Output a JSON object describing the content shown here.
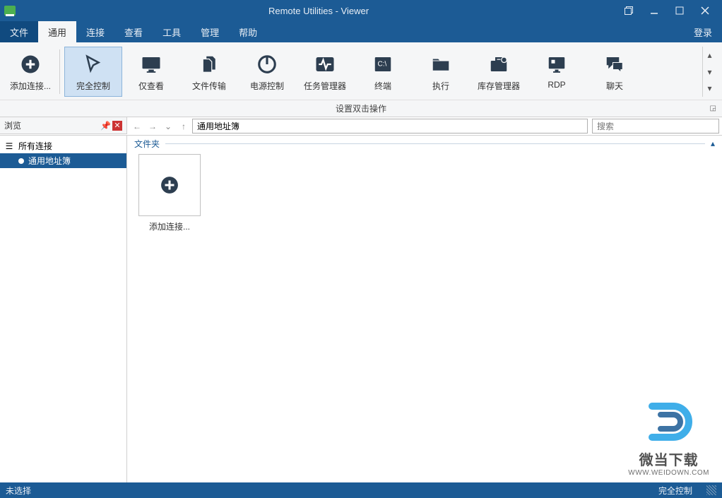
{
  "window": {
    "title": "Remote Utilities - Viewer"
  },
  "menu": {
    "file": "文件",
    "general": "通用",
    "connection": "连接",
    "view": "查看",
    "tools": "工具",
    "manage": "管理",
    "help": "帮助",
    "login": "登录"
  },
  "ribbon": {
    "add_connection": "添加连接...",
    "full_control": "完全控制",
    "view_only": "仅查看",
    "file_transfer": "文件传输",
    "power_control": "电源控制",
    "task_manager": "任务管理器",
    "terminal": "终端",
    "execute": "执行",
    "inventory_manager": "库存管理器",
    "rdp": "RDP",
    "chat": "聊天",
    "caption": "设置双击操作"
  },
  "sidebar": {
    "title": "浏览",
    "items": [
      {
        "label": "所有连接"
      },
      {
        "label": "通用地址簿"
      }
    ]
  },
  "nav": {
    "address": "通用地址簿",
    "search_placeholder": "搜索"
  },
  "content": {
    "folder_header": "文件夹",
    "tile_add": "添加连接..."
  },
  "footer": {
    "left": "未选择",
    "right": "完全控制"
  },
  "watermark": {
    "line1": "微当下载",
    "line2": "WWW.WEIDOWN.COM"
  }
}
